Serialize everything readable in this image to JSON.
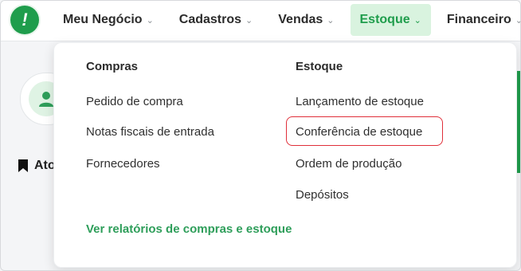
{
  "nav": {
    "items": [
      {
        "label": "Meu Negócio",
        "active": false
      },
      {
        "label": "Cadastros",
        "active": false
      },
      {
        "label": "Vendas",
        "active": false
      },
      {
        "label": "Estoque",
        "active": true
      },
      {
        "label": "Financeiro",
        "active": false
      }
    ]
  },
  "logo": {
    "glyph": "!"
  },
  "background": {
    "section_heading": "Ato"
  },
  "dropdown": {
    "compras": {
      "title": "Compras",
      "links": [
        "Pedido de compra",
        "Notas fiscais de entrada",
        "Fornecedores"
      ]
    },
    "estoque": {
      "title": "Estoque",
      "links": [
        "Lançamento de estoque",
        "Conferência de estoque",
        "Ordem de produção",
        "Depósitos"
      ]
    },
    "report_link": "Ver relatórios de compras e estoque",
    "highlighted_item": "Conferência de estoque"
  },
  "colors": {
    "brand_green": "#1f9d4c",
    "active_tab_bg": "#d9f3df",
    "report_link": "#2e9e5a",
    "highlight_border": "#e0303a"
  }
}
